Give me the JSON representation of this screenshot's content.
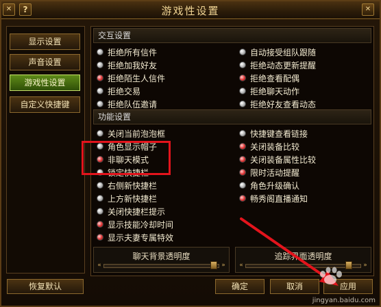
{
  "window": {
    "title": "游戏性设置",
    "help_glyph": "?",
    "close_glyph": "✕",
    "minimize_glyph": "✕"
  },
  "sidebar": {
    "items": [
      {
        "label": "显示设置",
        "active": false
      },
      {
        "label": "声音设置",
        "active": false
      },
      {
        "label": "游戏性设置",
        "active": true
      },
      {
        "label": "自定义快捷键",
        "active": false
      }
    ]
  },
  "interaction": {
    "heading": "交互设置",
    "left": [
      "拒绝所有信件",
      "拒绝加我好友",
      "拒绝陌生人信件",
      "拒绝交易",
      "拒绝队伍邀请"
    ],
    "right": [
      "自动接受组队跟随",
      "拒绝动态更新提醒",
      "拒绝查看配偶",
      "拒绝聊天动作",
      "拒绝好友查看动态"
    ],
    "left_red": [
      false,
      false,
      true,
      false,
      false
    ],
    "right_red": [
      false,
      false,
      true,
      false,
      false
    ]
  },
  "functions": {
    "heading": "功能设置",
    "left": [
      "关闭当前泡泡框",
      "角色显示帽子",
      "非聊天模式",
      "锁定快捷栏",
      "右侧新快捷栏",
      "上方新快捷栏",
      "关闭快捷栏提示",
      "显示技能冷却时间",
      "显示夫妻专属特效"
    ],
    "right": [
      "快捷键查看链接",
      "关闭装备比较",
      "关闭装备属性比较",
      "限时活动提醒",
      "角色升级确认",
      "畅秀阁直播通知"
    ],
    "left_red": [
      false,
      false,
      true,
      false,
      false,
      false,
      false,
      true,
      true
    ],
    "right_red": [
      false,
      true,
      true,
      true,
      false,
      true
    ]
  },
  "sliders": {
    "chat_bg_label": "聊天背景透明度",
    "track_label": "追踪界面透明度"
  },
  "buttons": {
    "restore_default": "恢复默认",
    "confirm": "确定",
    "cancel": "取消",
    "apply": "应用"
  },
  "watermark": {
    "site": "jingyan.baidu.com"
  },
  "colors": {
    "annotation_red": "#e3141c",
    "active_tab_green": "#4a7a10",
    "accent_gold": "#f0d493"
  }
}
